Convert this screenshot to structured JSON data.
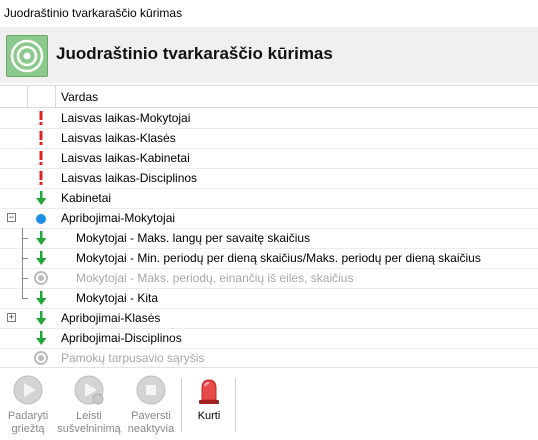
{
  "window": {
    "title": "Juodraštinio tvarkaraščio kūrimas"
  },
  "header": {
    "title": "Juodraštinio tvarkaraščio kūrimas",
    "icon": "target-icon",
    "icon_color": "#8cc98c"
  },
  "grid": {
    "column_header": "Vardas",
    "rows": [
      {
        "label": "Laisvas laikas-Mokytojai",
        "status": "error",
        "level": 0,
        "disabled": false
      },
      {
        "label": "Laisvas laikas-Klasės",
        "status": "error",
        "level": 0,
        "disabled": false
      },
      {
        "label": "Laisvas laikas-Kabinetai",
        "status": "error",
        "level": 0,
        "disabled": false
      },
      {
        "label": "Laisvas laikas-Disciplinos",
        "status": "error",
        "level": 0,
        "disabled": false
      },
      {
        "label": "Kabinetai",
        "status": "ok",
        "level": 0,
        "disabled": false
      },
      {
        "label": "Apribojimai-Mokytojai",
        "status": "active",
        "level": 0,
        "disabled": false,
        "expander": "−"
      },
      {
        "label": "Mokytojai - Maks. langų per savaitę skaičius",
        "status": "ok",
        "level": 1,
        "disabled": false
      },
      {
        "label": "Mokytojai - Min. periodų per dieną skaičius/Maks. periodų per dieną skaičius",
        "status": "ok",
        "level": 1,
        "disabled": false
      },
      {
        "label": "Mokytojai - Maks. periodų, einančių iš eilės, skaičius",
        "status": "inactive",
        "level": 1,
        "disabled": true
      },
      {
        "label": "Mokytojai - Kita",
        "status": "ok",
        "level": 1,
        "disabled": false
      },
      {
        "label": "Apribojimai-Klasės",
        "status": "ok",
        "level": 0,
        "disabled": false,
        "expander": "+"
      },
      {
        "label": "Apribojimai-Disciplinos",
        "status": "ok",
        "level": 0,
        "disabled": false
      },
      {
        "label": "Pamokų tarpusavio sąryšis",
        "status": "inactive",
        "level": 0,
        "disabled": true
      }
    ]
  },
  "toolbar": {
    "stricter": {
      "line1": "Padaryti",
      "line2": "griežtą"
    },
    "relax": {
      "line1": "Leisti",
      "line2": "sušvelninimą"
    },
    "deactivate": {
      "line1": "Paversti",
      "line2": "neaktyvia"
    },
    "create": {
      "line1": "Kurti"
    }
  },
  "colors": {
    "error": "#e02020",
    "ok": "#22a63a",
    "active": "#1e90e8",
    "inactive": "#bdbdbd",
    "create_button": "#e84a4a"
  }
}
